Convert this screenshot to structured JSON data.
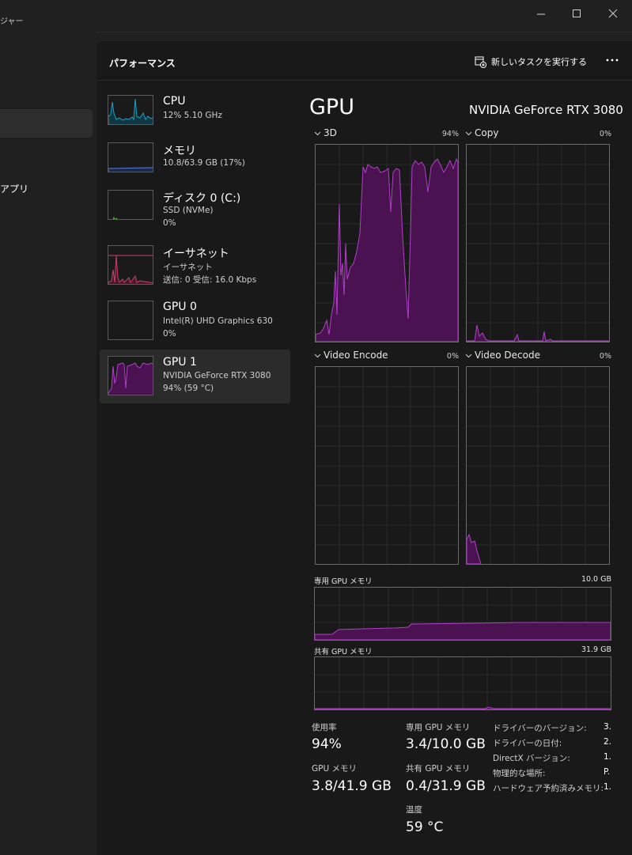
{
  "window": {
    "title": "ジャー"
  },
  "colors": {
    "gpu_accent": "#a020c0",
    "cpu_accent": "#1aa0c8",
    "memory_accent": "#5a7fd8",
    "disk_accent": "#5ab43a",
    "ethernet_accent": "#c8406a"
  },
  "nav": {
    "apps_label": "アプリ"
  },
  "header": {
    "title": "パフォーマンス",
    "run_task_label": "新しいタスクを実行する",
    "run_task_icon": "run-task-icon",
    "more_icon": "more-icon"
  },
  "sidebar": {
    "items": [
      {
        "name": "CPU",
        "line1": "12%  5.10 GHz",
        "line2": "",
        "line3": ""
      },
      {
        "name": "メモリ",
        "line1": "10.8/63.9 GB (17%)",
        "line2": "",
        "line3": ""
      },
      {
        "name": "ディスク 0 (C:)",
        "line1": "SSD (NVMe)",
        "line2": "0%",
        "line3": ""
      },
      {
        "name": "イーサネット",
        "line1": "イーサネット",
        "line2": "送信: 0 受信: 16.0 Kbps",
        "line3": ""
      },
      {
        "name": "GPU 0",
        "line1": "Intel(R) UHD Graphics 630",
        "line2": "0%",
        "line3": ""
      },
      {
        "name": "GPU 1",
        "line1": "NVIDIA GeForce RTX 3080",
        "line2": "94% (59 °C)",
        "line3": ""
      }
    ]
  },
  "detail": {
    "title": "GPU",
    "model": "NVIDIA GeForce RTX 3080",
    "engines": [
      {
        "label": "3D",
        "percent": "94%"
      },
      {
        "label": "Copy",
        "percent": "0%"
      },
      {
        "label": "Video Encode",
        "percent": "0%"
      },
      {
        "label": "Video Decode",
        "percent": "0%"
      }
    ],
    "dedicated_memory": {
      "label": "専用 GPU メモリ",
      "max": "10.0 GB"
    },
    "shared_memory": {
      "label": "共有 GPU メモリ",
      "max": "31.9 GB"
    },
    "stats": {
      "utilization_label": "使用率",
      "utilization_value": "94%",
      "dedicated_label": "専用 GPU メモリ",
      "dedicated_value": "3.4/10.0 GB",
      "gpu_memory_label": "GPU メモリ",
      "gpu_memory_value": "3.8/41.9 GB",
      "shared_label": "共有 GPU メモリ",
      "shared_value": "0.4/31.9 GB",
      "temp_label": "温度",
      "temp_value": "59 °C"
    },
    "info": [
      {
        "label": "ドライバーのバージョン:",
        "value": "3."
      },
      {
        "label": "ドライバーの日付:",
        "value": "2."
      },
      {
        "label": "DirectX バージョン:",
        "value": "1."
      },
      {
        "label": "物理的な場所:",
        "value": "P."
      },
      {
        "label": "ハードウェア予約済みメモリ:",
        "value": "1."
      }
    ]
  }
}
